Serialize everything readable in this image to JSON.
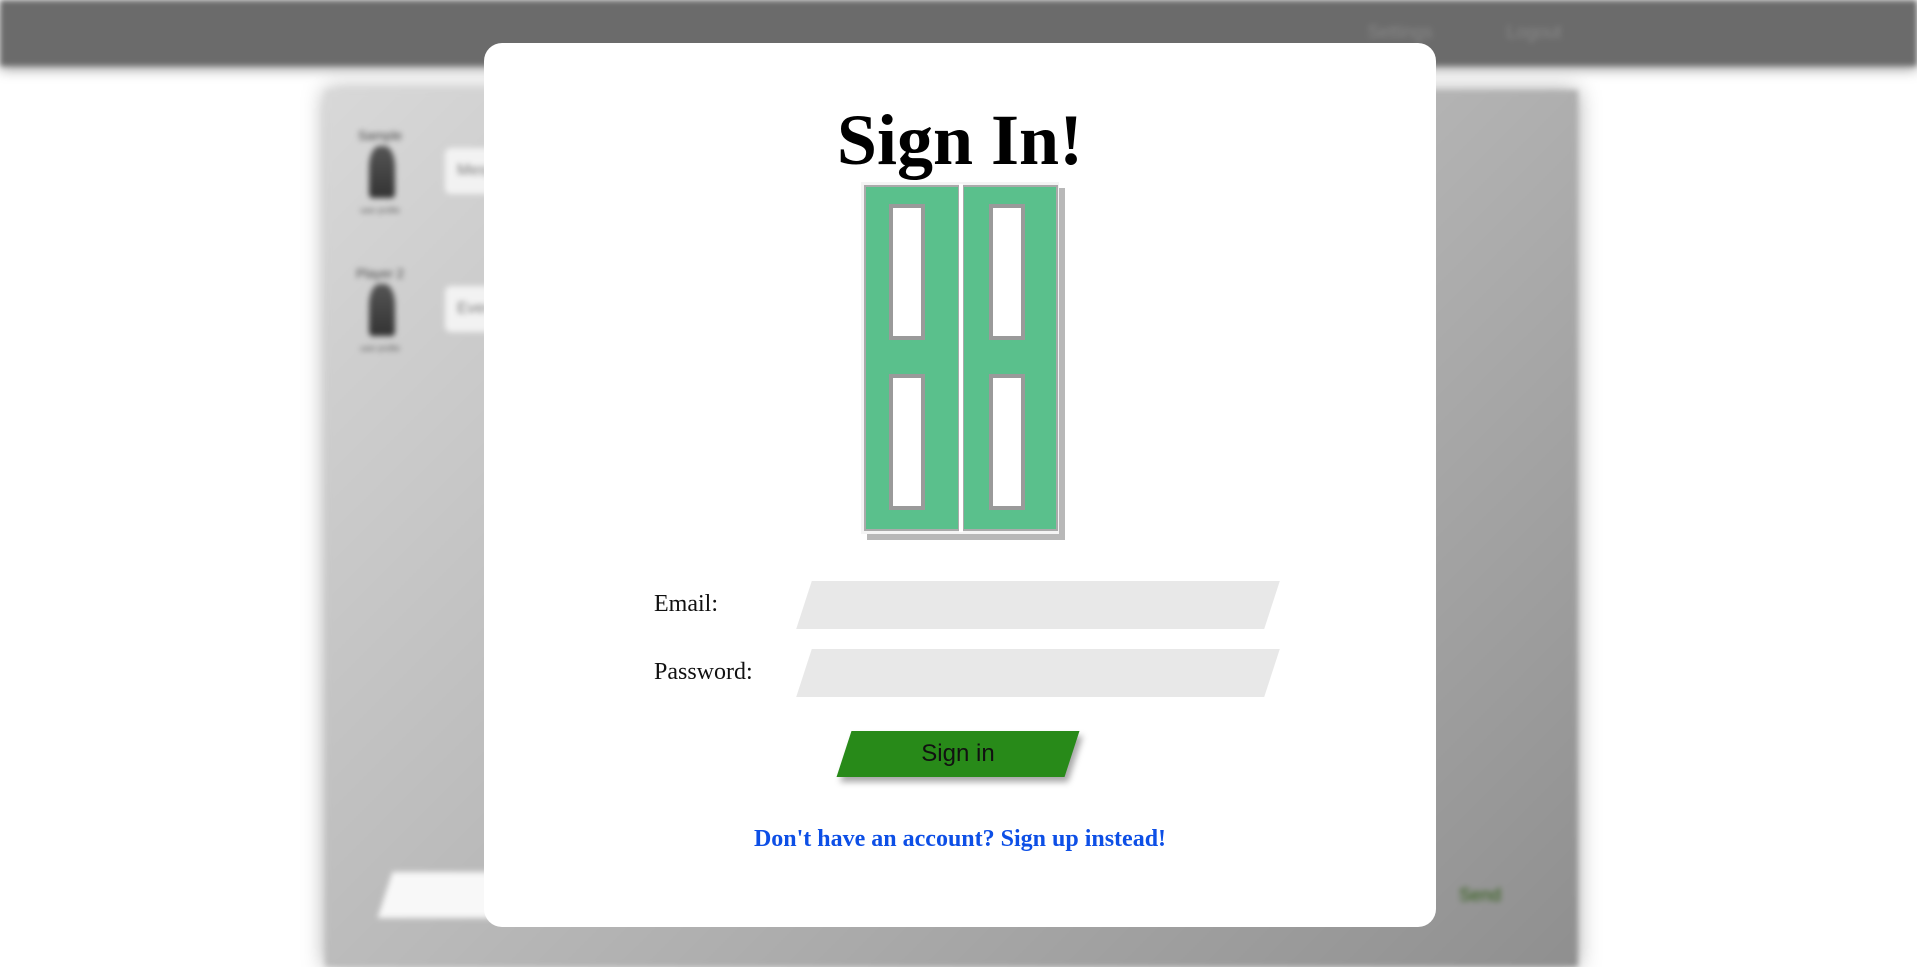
{
  "background": {
    "topbar": {
      "settings_label": "Settings",
      "logout_label": "Logout"
    },
    "entries": [
      {
        "label": "Sample",
        "sub": "user profile",
        "text": "Mess"
      },
      {
        "label": "Player 2",
        "sub": "user profile",
        "text": "Ever"
      }
    ],
    "send_label": "Send"
  },
  "modal": {
    "title": "Sign In!",
    "door_icon": "door-icon",
    "email_label": "Email:",
    "email_value": "",
    "password_label": "Password:",
    "password_value": "",
    "submit_label": "Sign in",
    "signup_link": "Don't have an account? Sign up instead!"
  },
  "colors": {
    "door": "#5ac08c",
    "button": "#288a19",
    "link": "#0d4fe6",
    "field": "#e8e8e8"
  }
}
